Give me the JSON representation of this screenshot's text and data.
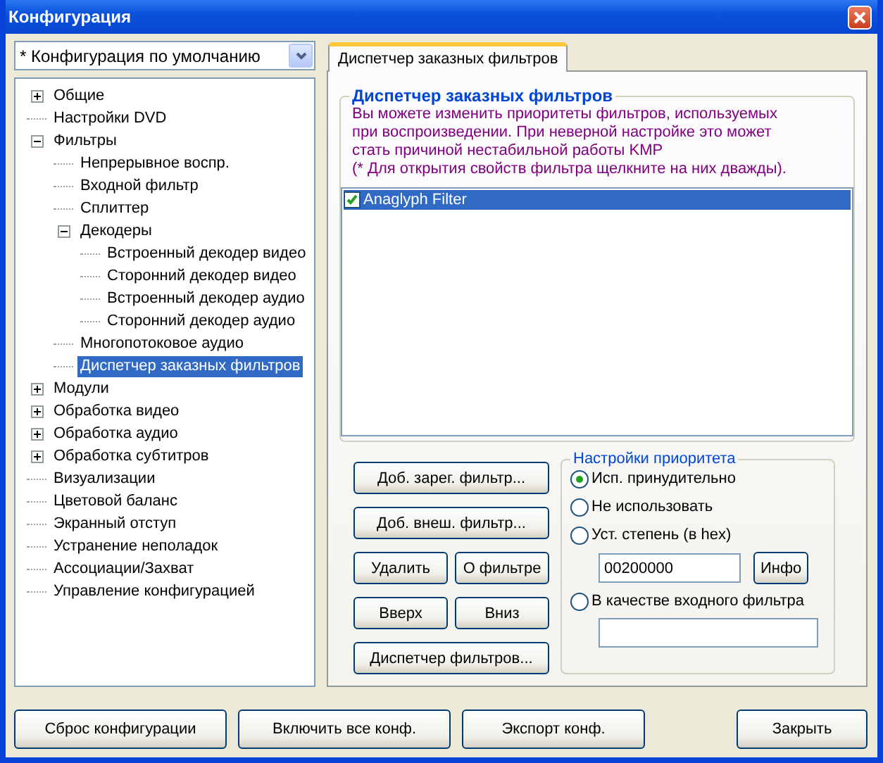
{
  "window": {
    "title": "Конфигурация"
  },
  "config_select": {
    "value": "* Конфигурация по умолчанию"
  },
  "tree": [
    {
      "label": "Общие",
      "kind": "folder",
      "expanded": false,
      "selected": false
    },
    {
      "label": "Настройки DVD",
      "kind": "leaf",
      "selected": false
    },
    {
      "label": "Фильтры",
      "kind": "folder",
      "expanded": true,
      "selected": false,
      "children": [
        {
          "label": "Непрерывное воспр.",
          "kind": "leaf",
          "selected": false
        },
        {
          "label": "Входной фильтр",
          "kind": "leaf",
          "selected": false
        },
        {
          "label": "Сплиттер",
          "kind": "leaf",
          "selected": false
        },
        {
          "label": "Декодеры",
          "kind": "folder",
          "expanded": true,
          "selected": false,
          "children": [
            {
              "label": "Встроенный декодер видео",
              "kind": "leaf",
              "selected": false
            },
            {
              "label": "Сторонний декодер видео",
              "kind": "leaf",
              "selected": false
            },
            {
              "label": "Встроенный декодер аудио",
              "kind": "leaf",
              "selected": false
            },
            {
              "label": "Сторонний декодер аудио",
              "kind": "leaf",
              "selected": false
            }
          ]
        },
        {
          "label": "Многопотоковое аудио",
          "kind": "leaf",
          "selected": false
        },
        {
          "label": "Диспетчер заказных фильтров",
          "kind": "leaf",
          "selected": true
        }
      ]
    },
    {
      "label": "Модули",
      "kind": "folder",
      "expanded": false,
      "selected": false
    },
    {
      "label": "Обработка видео",
      "kind": "folder",
      "expanded": false,
      "selected": false
    },
    {
      "label": "Обработка аудио",
      "kind": "folder",
      "expanded": false,
      "selected": false
    },
    {
      "label": "Обработка субтитров",
      "kind": "folder",
      "expanded": false,
      "selected": false
    },
    {
      "label": "Визуализации",
      "kind": "leaf",
      "selected": false
    },
    {
      "label": "Цветовой баланс",
      "kind": "leaf",
      "selected": false
    },
    {
      "label": "Экранный отступ",
      "kind": "leaf",
      "selected": false
    },
    {
      "label": "Устранение неполадок",
      "kind": "leaf",
      "selected": false
    },
    {
      "label": "Ассоциации/Захват",
      "kind": "leaf",
      "selected": false
    },
    {
      "label": "Управление конфигурацией",
      "kind": "leaf",
      "selected": false
    }
  ],
  "tabs": [
    {
      "label": "Диспетчер заказных фильтров",
      "selected": true
    }
  ],
  "filters_group": {
    "title": "Диспетчер заказных фильтров",
    "description": "Вы можете изменить приоритеты фильтров, используемых\nпри воспроизведении. При неверной настройке это может\nстать причиной нестабильной работы KMP",
    "note": "(* Для открытия свойств фильтра щелкните на них дважды)."
  },
  "filters": [
    {
      "name": "Anaglyph Filter",
      "checked": true,
      "selected": true
    }
  ],
  "filter_buttons": [
    {
      "label": "Доб. зарег. фильтр...",
      "kind": "wide"
    },
    {
      "label": "Доб. внеш. фильтр...",
      "kind": "wide"
    },
    {
      "label": "Удалить",
      "kind": "half"
    },
    {
      "label": "О фильтре",
      "kind": "half"
    },
    {
      "label": "Вверх",
      "kind": "half"
    },
    {
      "label": "Вниз",
      "kind": "half"
    },
    {
      "label": "Диспетчер фильтров...",
      "kind": "wide"
    }
  ],
  "priority": {
    "title": "Настройки приоритета",
    "options": [
      {
        "label": "Исп. принудительно",
        "kind": "plain",
        "selected": true
      },
      {
        "label": "Не использовать",
        "kind": "plain",
        "selected": false
      },
      {
        "label": "Уст. степень (в hex)",
        "kind": "hex",
        "selected": false,
        "field": "00200000",
        "button": "Инфо"
      },
      {
        "label": "В качестве входного фильтра",
        "kind": "path",
        "selected": false
      }
    ]
  },
  "bottom_buttons": [
    {
      "label": "Сброс конфигурации",
      "kind": "left"
    },
    {
      "label": "Включить все конф.",
      "kind": "left"
    },
    {
      "label": "Экспорт конф.",
      "kind": "left"
    },
    {
      "label": "Закрыть",
      "kind": "right"
    }
  ]
}
